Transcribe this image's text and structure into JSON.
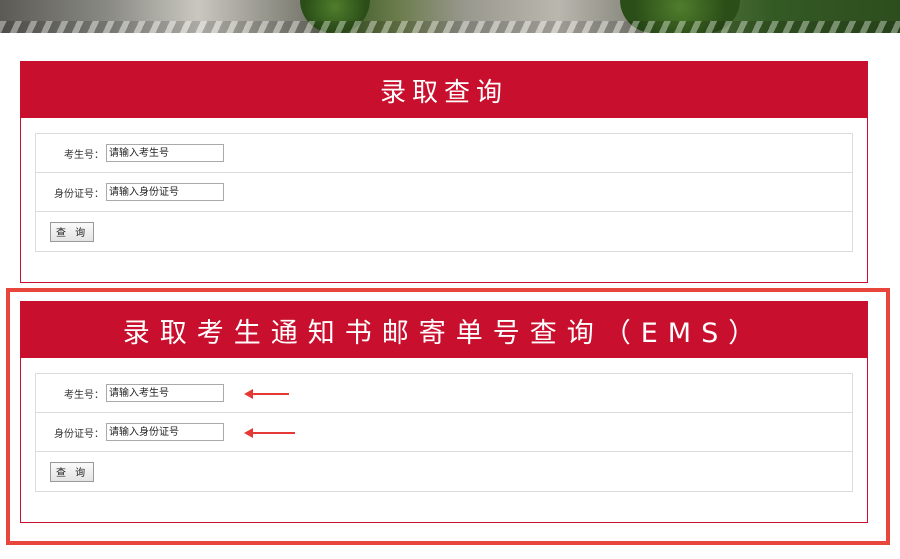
{
  "panel1": {
    "title": "录取查询",
    "exam_label": "考生号：",
    "exam_placeholder": "请输入考生号",
    "id_label": "身份证号：",
    "id_placeholder": "请输入身份证号",
    "submit": "查 询"
  },
  "panel2": {
    "title": "录取考生通知书邮寄单号查询（EMS）",
    "exam_label": "考生号：",
    "exam_placeholder": "请输入考生号",
    "id_label": "身份证号：",
    "id_placeholder": "请输入身份证号",
    "submit": "查 询"
  },
  "colors": {
    "brand_red": "#c8102e",
    "highlight_red": "#e8453c"
  }
}
